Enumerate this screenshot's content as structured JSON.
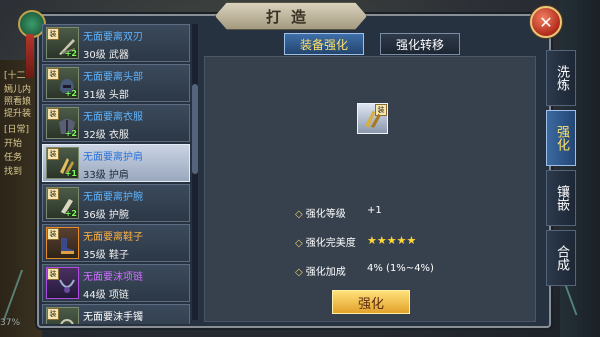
{
  "title": "打造",
  "close_icon": "close-icon",
  "background_chat": [
    "[十二",
    "嫣儿内",
    "照看娘",
    "提升装",
    "[日常]",
    "开始",
    "任务",
    "找到"
  ],
  "bottom_left": "37%",
  "tabs": [
    {
      "label": "装备强化",
      "active": true
    },
    {
      "label": "强化转移",
      "active": false
    }
  ],
  "side_tabs": [
    {
      "label": "洗炼",
      "active": false
    },
    {
      "label": "强化",
      "active": true
    },
    {
      "label": "镶嵌",
      "active": false
    },
    {
      "label": "合成",
      "active": false
    }
  ],
  "equipment": [
    {
      "name": "无面要离双刃",
      "name_color": "blue",
      "level_text": "30级 武器",
      "plus": "+2",
      "selected": false,
      "quality": "normal",
      "icon": "dual-blade-icon"
    },
    {
      "name": "无面要离头部",
      "name_color": "blue",
      "level_text": "31级 头部",
      "plus": "+2",
      "selected": false,
      "quality": "normal",
      "icon": "helmet-icon"
    },
    {
      "name": "无面要离衣服",
      "name_color": "blue",
      "level_text": "32级 衣服",
      "plus": "+2",
      "selected": false,
      "quality": "normal",
      "icon": "armor-icon"
    },
    {
      "name": "无面要离护肩",
      "name_color": "blue",
      "level_text": "33级 护肩",
      "plus": "+1",
      "selected": true,
      "quality": "normal",
      "icon": "shoulder-guard-icon"
    },
    {
      "name": "无面要离护腕",
      "name_color": "blue",
      "level_text": "36级 护腕",
      "plus": "+2",
      "selected": false,
      "quality": "normal",
      "icon": "bracer-icon"
    },
    {
      "name": "无面要离鞋子",
      "name_color": "orange",
      "level_text": "35级 鞋子",
      "plus": "",
      "selected": false,
      "quality": "orange",
      "icon": "boots-icon"
    },
    {
      "name": "无面要沫项链",
      "name_color": "purple",
      "level_text": "44级 项链",
      "plus": "",
      "selected": false,
      "quality": "purple",
      "icon": "necklace-icon"
    },
    {
      "name": "无面要沫手镯",
      "name_color": "white",
      "level_text": "",
      "plus": "",
      "selected": false,
      "quality": "normal",
      "icon": "bangle-icon"
    }
  ],
  "equip_badge": "装",
  "selected_item_icon": "shoulder-guard-icon",
  "stats": {
    "level_label": "强化等级",
    "level_value": "+1",
    "perfection_label": "强化完美度",
    "perfection_stars": 5,
    "bonus_label": "强化加成",
    "bonus_value": "4% (1%~4%)"
  },
  "strengthen_button": "强化",
  "colors": {
    "accent_gold": "#ffe26a",
    "name_blue": "#5fb4ff",
    "name_orange": "#ffb040",
    "name_purple": "#d070ff"
  }
}
